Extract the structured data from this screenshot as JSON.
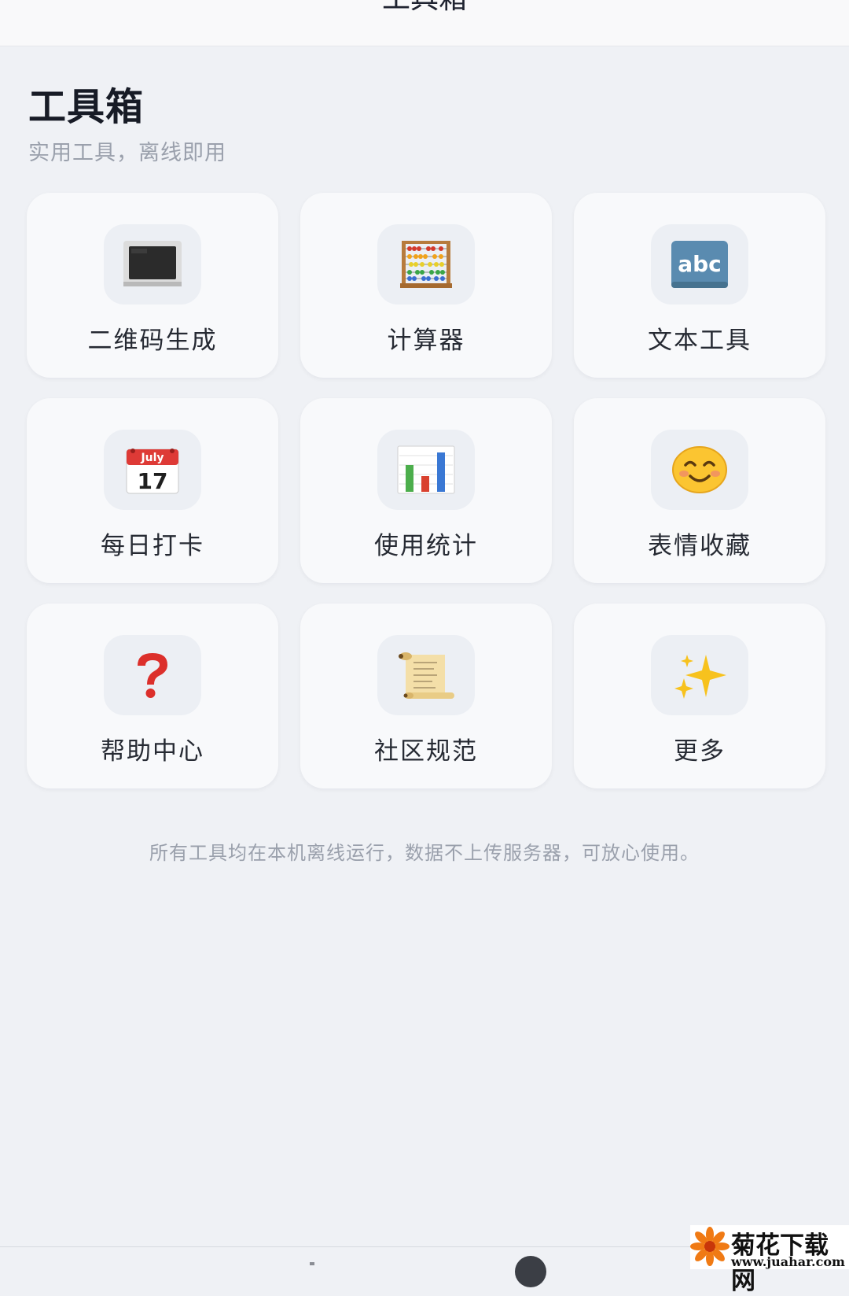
{
  "header": {
    "title": "工具箱"
  },
  "page": {
    "title": "工具箱",
    "subtitle": "实用工具，离线即用"
  },
  "tools": [
    {
      "label": "二维码生成",
      "icon": "computer-screen-icon"
    },
    {
      "label": "计算器",
      "icon": "abacus-icon"
    },
    {
      "label": "文本工具",
      "icon": "abc-icon",
      "icon_text": "abc"
    },
    {
      "label": "每日打卡",
      "icon": "calendar-icon",
      "icon_month": "July",
      "icon_day": "17"
    },
    {
      "label": "使用统计",
      "icon": "bar-chart-icon"
    },
    {
      "label": "表情收藏",
      "icon": "smiling-face-icon"
    },
    {
      "label": "帮助中心",
      "icon": "question-mark-icon"
    },
    {
      "label": "社区规范",
      "icon": "scroll-icon"
    },
    {
      "label": "更多",
      "icon": "sparkles-icon"
    }
  ],
  "footer": {
    "note": "所有工具均在本机离线运行，数据不上传服务器，可放心使用。"
  },
  "watermark": {
    "name": "菊花下载网",
    "url": "www.juahar.com"
  }
}
